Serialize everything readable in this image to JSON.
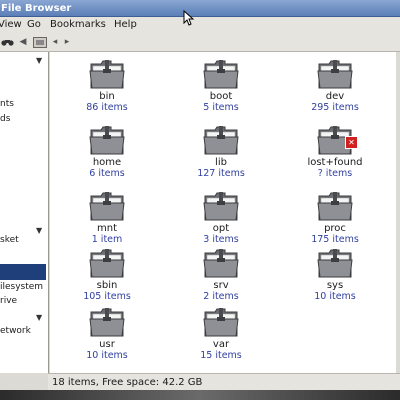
{
  "window": {
    "title": "File Browser"
  },
  "menu": {
    "view": "View",
    "go": "Go",
    "bookmarks": "Bookmarks",
    "help": "Help"
  },
  "sidebar": {
    "items": [
      {
        "label": "nts"
      },
      {
        "label": "ds"
      },
      {
        "label": "sket"
      },
      {
        "label": "ilesystem"
      },
      {
        "label": "rive"
      },
      {
        "label": "etwork"
      }
    ]
  },
  "folders": [
    {
      "name": "bin",
      "count": "86 items"
    },
    {
      "name": "boot",
      "count": "5 items"
    },
    {
      "name": "dev",
      "count": "295 items"
    },
    {
      "name": "home",
      "count": "6 items"
    },
    {
      "name": "lib",
      "count": "127 items"
    },
    {
      "name": "lost+found",
      "count": "? items"
    },
    {
      "name": "mnt",
      "count": "1 item"
    },
    {
      "name": "opt",
      "count": "3 items"
    },
    {
      "name": "proc",
      "count": "175 items"
    },
    {
      "name": "sbin",
      "count": "105 items"
    },
    {
      "name": "srv",
      "count": "2 items"
    },
    {
      "name": "sys",
      "count": "10 items"
    },
    {
      "name": "usr",
      "count": "10 items"
    },
    {
      "name": "var",
      "count": "15 items"
    }
  ],
  "status": {
    "text": "18 items, Free space: 42.2 GB"
  },
  "colors": {
    "selection": "#1f3f7a",
    "count_text": "#2f3fa0",
    "titlebar": "#5b7fb8"
  }
}
